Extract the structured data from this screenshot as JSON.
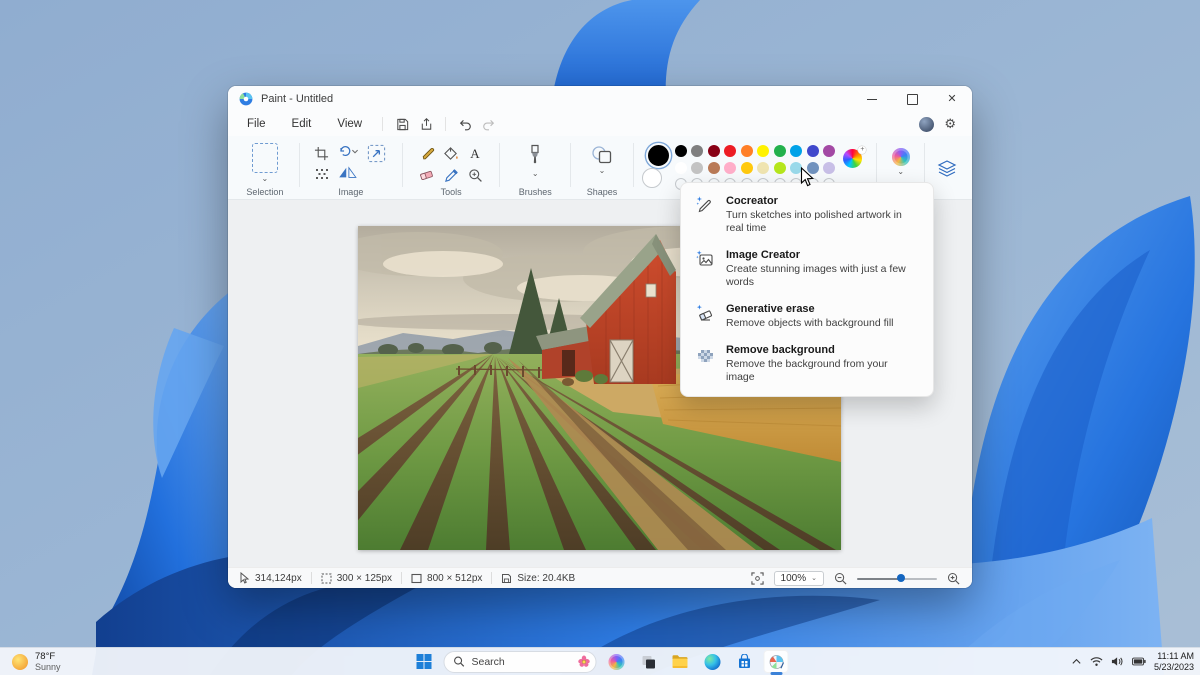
{
  "window": {
    "title": "Paint - Untitled",
    "app": "Microsoft Paint"
  },
  "menubar": {
    "items": [
      "File",
      "Edit",
      "View"
    ]
  },
  "ribbon": {
    "groups": [
      "Selection",
      "Image",
      "Tools",
      "Brushes",
      "Shapes",
      "Color"
    ]
  },
  "palette": {
    "selected_primary": "#000000",
    "selected_secondary": "#ffffff",
    "row1": [
      "#000000",
      "#7f7f7f",
      "#880015",
      "#ed1c24",
      "#ff7f27",
      "#fff200",
      "#22b14c",
      "#00a2e8",
      "#3f48cc",
      "#a349a4"
    ],
    "row2": [
      "#ffffff",
      "#c3c3c3",
      "#b97a57",
      "#ffaec9",
      "#ffc90e",
      "#efe4b0",
      "#b5e61d",
      "#99d9ea",
      "#7092be",
      "#c8bfe7"
    ],
    "empty_slots": 10
  },
  "copilot_menu": {
    "items": [
      {
        "title": "Cocreator",
        "desc": "Turn sketches into polished artwork in real time",
        "icon": "pencil-sparkle-icon"
      },
      {
        "title": "Image Creator",
        "desc": "Create stunning images with just a few words",
        "icon": "image-sparkle-icon"
      },
      {
        "title": "Generative erase",
        "desc": "Remove objects with background fill",
        "icon": "eraser-sparkle-icon"
      },
      {
        "title": "Remove background",
        "desc": "Remove the background from your image",
        "icon": "checkerboard-icon"
      }
    ]
  },
  "statusbar": {
    "cursor_position": "314,124px",
    "selection_size": "300 × 125px",
    "canvas_size": "800 × 512px",
    "file_size": "Size: 20.4KB",
    "zoom_level": "100%"
  },
  "taskbar": {
    "weather": {
      "temperature": "78°F",
      "condition": "Sunny"
    },
    "search": {
      "placeholder": "Search"
    },
    "clock": {
      "time": "11:11 AM",
      "date": "5/23/2023"
    }
  },
  "colors": {
    "accent": "#2f7de2",
    "window_chrome": "#f7fafc",
    "taskbar_bg": "#f2f6fb"
  }
}
